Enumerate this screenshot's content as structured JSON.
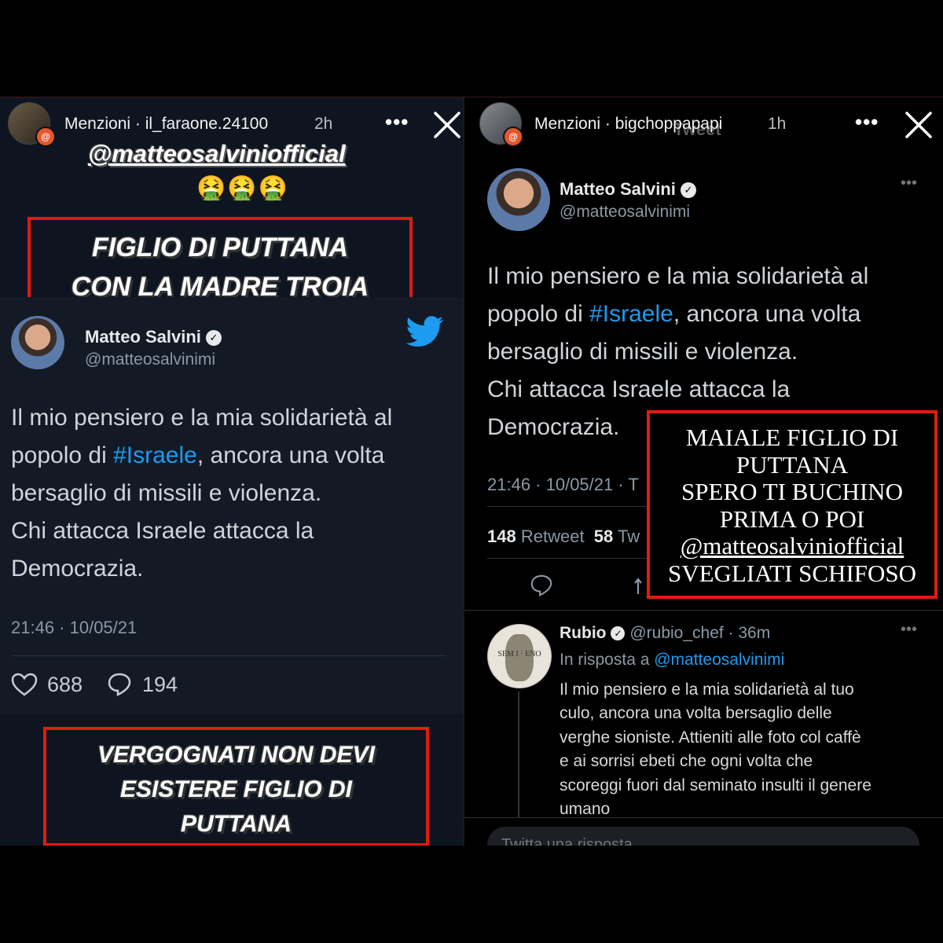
{
  "left_story": {
    "header": {
      "avatar_badge": "@",
      "name": "Menzioni · il_faraone.24100",
      "time": "2h",
      "more_icon": "ellipsis-icon",
      "close_icon": "close-icon"
    },
    "mention_text": "@matteosalviniofficial",
    "emojis": "🤮🤮🤮",
    "caption_top": [
      "FIGLIO DI PUTTANA",
      "CON LA MADRE TROIA"
    ],
    "tweet": {
      "name": "Matteo Salvini",
      "handle": "@matteosalvinimi",
      "body_lines": [
        "Il mio pensiero e la mia solidarietà al",
        "popolo di ",
        "#Israele",
        ", ancora una volta",
        "bersaglio di missili e violenza.",
        "Chi attacca Israele attacca la",
        "Democrazia."
      ],
      "timestamp": "21:46 · 10/05/21",
      "likes": "688",
      "replies": "194",
      "brand_icon": "twitter-bird-icon"
    },
    "caption_bottom": [
      "VERGOGNATI NON DEVI",
      "ESISTERE FIGLIO DI",
      "PUTTANA"
    ]
  },
  "right_story": {
    "header": {
      "avatar_badge": "@",
      "name": "Menzioni · bigchoppapapi",
      "time": "1h",
      "ghost_title": "Tweet",
      "more_icon": "ellipsis-icon",
      "close_icon": "close-icon"
    },
    "tweet": {
      "name": "Matteo Salvini",
      "handle": "@matteosalvinimi",
      "body_lines": [
        "Il mio pensiero e la mia solidarietà al",
        "popolo di ",
        "#Israele",
        ", ancora una volta",
        "bersaglio di missili e violenza.",
        "Chi attacca Israele attacca la",
        "Democrazia."
      ],
      "timestamp": "21:46 · 10/05/21 · T",
      "retweets_num": "148",
      "retweets_label": "Retweet",
      "quotes_num": "58",
      "quotes_label": "Tw"
    },
    "overlay_lines": [
      "MAIALE FIGLIO DI",
      "PUTTANA",
      "SPERO TI BUCHINO",
      "PRIMA O POI",
      "@matteosalviniofficial",
      "SVEGLIATI SCHIFOSO"
    ],
    "reply": {
      "name": "Rubio",
      "handle_time": "@rubio_chef · 36m",
      "in_reply_prefix": "In risposta a ",
      "in_reply_handle": "@matteosalvinimi",
      "coin_text": "SEM I · ENO",
      "text_lines": [
        "Il mio pensiero e la mia solidarietà al tuo",
        "culo, ancora una volta bersaglio delle",
        "verghe sioniste. Attieniti alle foto col caffè",
        "e ai sorrisi ebeti che ogni volta che",
        "scoreggi fuori dal seminato insulti il genere",
        "umano"
      ]
    },
    "reply_input_placeholder": "Twitta una risposta"
  },
  "colors": {
    "caption_border": "#e01b12",
    "link_blue": "#1d9bf0",
    "left_bg": "#0f1520",
    "right_bg": "#000000"
  }
}
